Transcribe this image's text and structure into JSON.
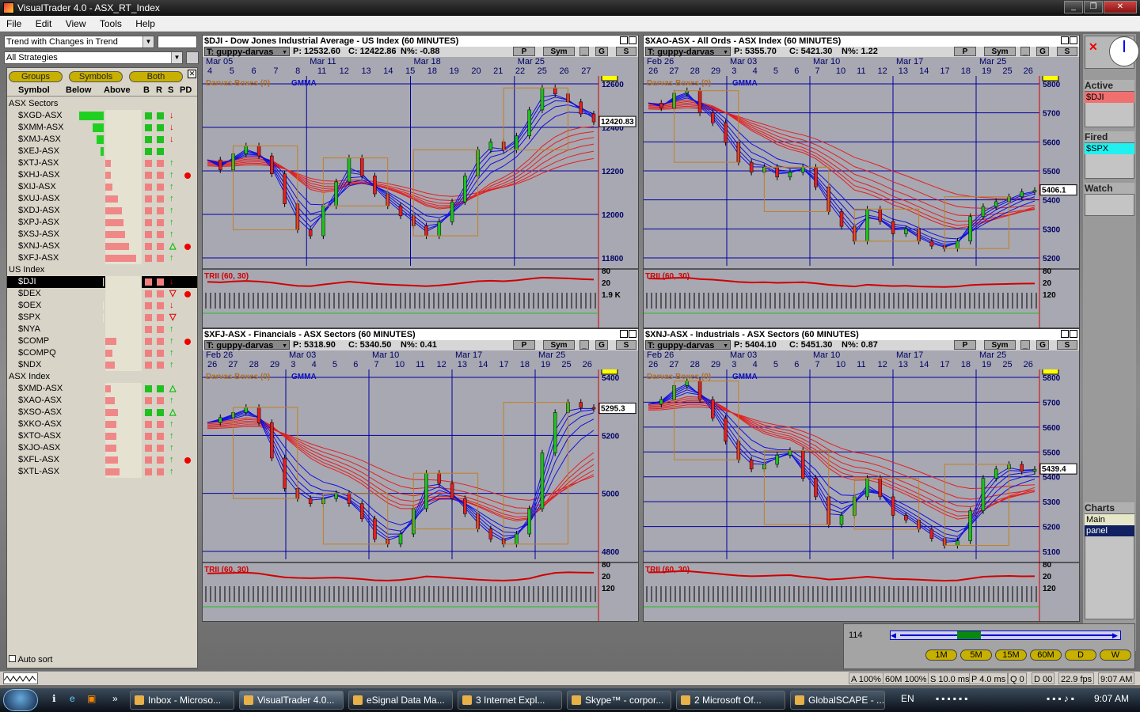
{
  "window": {
    "title": "VisualTrader 4.0 - ASX_RT_Index"
  },
  "menu": [
    "File",
    "Edit",
    "View",
    "Tools",
    "Help"
  ],
  "left": {
    "strategy": "Trend with Changes in Trend",
    "strategies_scope": "All Strategies",
    "buttons": [
      "Groups",
      "Symbols",
      "Both"
    ],
    "headers": [
      "Symbol",
      "Below",
      "Above",
      "B",
      "R",
      "S",
      "PD"
    ],
    "groups": [
      {
        "name": "ASX Sectors",
        "rows": [
          {
            "sym": "$XGD-ASX",
            "below": 0.9,
            "above": 0,
            "b": "#20c020",
            "r": "#20c020",
            "s": "↓",
            "scol": "#e00000",
            "pd": false
          },
          {
            "sym": "$XMM-ASX",
            "below": 0.4,
            "above": 0,
            "b": "#20c020",
            "r": "#20c020",
            "s": "↓",
            "scol": "#e00000",
            "pd": false
          },
          {
            "sym": "$XMJ-ASX",
            "below": 0.25,
            "above": 0,
            "b": "#20c020",
            "r": "#20c020",
            "s": "↓",
            "scol": "#e00000",
            "pd": false
          },
          {
            "sym": "$XEJ-ASX",
            "below": 0.12,
            "above": 0,
            "b": "#20c020",
            "r": "#20c020",
            "s": "",
            "scol": "#e00000",
            "pd": false
          },
          {
            "sym": "$XTJ-ASX",
            "below": 0,
            "above": 0.15,
            "b": "#f08080",
            "r": "#f08080",
            "s": "↑",
            "scol": "#00c000",
            "pd": false
          },
          {
            "sym": "$XHJ-ASX",
            "below": 0,
            "above": 0.15,
            "b": "#f08080",
            "r": "#f08080",
            "s": "↑",
            "scol": "#00c000",
            "pd": true
          },
          {
            "sym": "$XIJ-ASX",
            "below": 0,
            "above": 0.2,
            "b": "#f08080",
            "r": "#f08080",
            "s": "↑",
            "scol": "#00c000",
            "pd": false
          },
          {
            "sym": "$XUJ-ASX",
            "below": 0,
            "above": 0.35,
            "b": "#f08080",
            "r": "#f08080",
            "s": "↑",
            "scol": "#00c000",
            "pd": false
          },
          {
            "sym": "$XDJ-ASX",
            "below": 0,
            "above": 0.45,
            "b": "#f08080",
            "r": "#f08080",
            "s": "↑",
            "scol": "#00c000",
            "pd": false
          },
          {
            "sym": "$XPJ-ASX",
            "below": 0,
            "above": 0.5,
            "b": "#f08080",
            "r": "#f08080",
            "s": "↑",
            "scol": "#00c000",
            "pd": false
          },
          {
            "sym": "$XSJ-ASX",
            "below": 0,
            "above": 0.55,
            "b": "#f08080",
            "r": "#f08080",
            "s": "↑",
            "scol": "#00c000",
            "pd": false
          },
          {
            "sym": "$XNJ-ASX",
            "below": 0,
            "above": 0.65,
            "b": "#f08080",
            "r": "#f08080",
            "s": "△",
            "scol": "#00c000",
            "pd": true
          },
          {
            "sym": "$XFJ-ASX",
            "below": 0,
            "above": 0.85,
            "b": "#f08080",
            "r": "#f08080",
            "s": "↑",
            "scol": "#00c000",
            "pd": false
          }
        ]
      },
      {
        "name": "US Index",
        "rows": [
          {
            "sym": "$DJI",
            "below": 0.03,
            "above": 0,
            "b": "#f08080",
            "r": "#f08080",
            "s": "↓",
            "scol": "#e00000",
            "pd": false,
            "sel": true
          },
          {
            "sym": "$DEX",
            "below": 0,
            "above": 0,
            "b": "#f08080",
            "r": "#f08080",
            "s": "▽",
            "scol": "#e00000",
            "pd": true
          },
          {
            "sym": "$OEX",
            "below": 0.03,
            "above": 0,
            "b": "#f08080",
            "r": "#f08080",
            "s": "↓",
            "scol": "#e00000",
            "pd": false
          },
          {
            "sym": "$SPX",
            "below": 0.03,
            "above": 0,
            "b": "#f08080",
            "r": "#f08080",
            "s": "▽",
            "scol": "#e00000",
            "pd": false
          },
          {
            "sym": "$NYA",
            "below": 0,
            "above": 0,
            "b": "#f08080",
            "r": "#f08080",
            "s": "↑",
            "scol": "#00c000",
            "pd": false
          },
          {
            "sym": "$COMP",
            "below": 0,
            "above": 0.3,
            "b": "#f08080",
            "r": "#f08080",
            "s": "↑",
            "scol": "#00c000",
            "pd": true
          },
          {
            "sym": "$COMPQ",
            "below": 0,
            "above": 0.2,
            "b": "#f08080",
            "r": "#f08080",
            "s": "↑",
            "scol": "#00c000",
            "pd": false
          },
          {
            "sym": "$NDX",
            "below": 0,
            "above": 0.25,
            "b": "#f08080",
            "r": "#f08080",
            "s": "↑",
            "scol": "#00c000",
            "pd": false
          }
        ]
      },
      {
        "name": "ASX Index",
        "rows": [
          {
            "sym": "$XMD-ASX",
            "below": 0,
            "above": 0.15,
            "b": "#20c020",
            "r": "#20c020",
            "s": "△",
            "scol": "#00c000",
            "pd": false
          },
          {
            "sym": "$XAO-ASX",
            "below": 0,
            "above": 0.25,
            "b": "#f08080",
            "r": "#f08080",
            "s": "↑",
            "scol": "#00c000",
            "pd": false
          },
          {
            "sym": "$XSO-ASX",
            "below": 0,
            "above": 0.35,
            "b": "#20c020",
            "r": "#20c020",
            "s": "△",
            "scol": "#00c000",
            "pd": false
          },
          {
            "sym": "$XKO-ASX",
            "below": 0,
            "above": 0.3,
            "b": "#f08080",
            "r": "#f08080",
            "s": "↑",
            "scol": "#00c000",
            "pd": false
          },
          {
            "sym": "$XTO-ASX",
            "below": 0,
            "above": 0.3,
            "b": "#f08080",
            "r": "#f08080",
            "s": "↑",
            "scol": "#00c000",
            "pd": false
          },
          {
            "sym": "$XJO-ASX",
            "below": 0,
            "above": 0.3,
            "b": "#f08080",
            "r": "#f08080",
            "s": "↑",
            "scol": "#00c000",
            "pd": false
          },
          {
            "sym": "$XFL-ASX",
            "below": 0,
            "above": 0.35,
            "b": "#f08080",
            "r": "#f08080",
            "s": "↑",
            "scol": "#00c000",
            "pd": true
          },
          {
            "sym": "$XTL-ASX",
            "below": 0,
            "above": 0.4,
            "b": "#f08080",
            "r": "#f08080",
            "s": "↑",
            "scol": "#00c000",
            "pd": false
          }
        ]
      }
    ],
    "autosort": "Auto sort"
  },
  "charts": [
    {
      "id": "dji",
      "title": "$DJI - Dow Jones Industrial Average - US Index (60 MINUTES)",
      "tool": "T: guppy-darvas",
      "p": "P: 12532.60",
      "c": "C: 12422.86",
      "n": "N%: -0.88",
      "dates": [
        "Mar 05",
        "Mar 11",
        "Mar 18",
        "Mar 25"
      ],
      "days": [
        "4",
        "5",
        "6",
        "7",
        "8",
        "11",
        "12",
        "13",
        "14",
        "15",
        "18",
        "19",
        "20",
        "21",
        "22",
        "25",
        "26",
        "27"
      ],
      "yticks": [
        "12600",
        "12400",
        "12200",
        "12000",
        "11800"
      ],
      "last": "12420.83",
      "ind": [
        "80",
        "20",
        "1.9 K"
      ],
      "labels": [
        "Darvas Boxes (0)",
        "GMMA",
        "TRII (60, 30)"
      ],
      "chart_data": {
        "type": "line",
        "series": [
          {
            "values": [
              12230,
              12180,
              12260,
              12300,
              12250,
              12160,
              12010,
              11880,
              11850,
              12000,
              12120,
              12240,
              12150,
              12060,
              12000,
              11950,
              11900,
              11850,
              11920,
              12020,
              12150,
              12280,
              12320,
              12280,
              12350,
              12480,
              12590,
              12560,
              12520,
              12460,
              12420
            ]
          }
        ],
        "ylim": [
          11700,
          12650
        ]
      }
    },
    {
      "id": "xao",
      "title": "$XAO-ASX - All Ords - ASX Index (60 MINUTES)",
      "tool": "T: guppy-darvas",
      "p": "P: 5355.70",
      "c": "C: 5421.30",
      "n": "N%: 1.22",
      "dates": [
        "Feb 26",
        "Mar 03",
        "Mar 10",
        "Mar 17",
        "Mar 25"
      ],
      "days": [
        "26",
        "27",
        "28",
        "29",
        "3",
        "4",
        "5",
        "6",
        "7",
        "10",
        "11",
        "12",
        "13",
        "14",
        "17",
        "18",
        "19",
        "25",
        "26"
      ],
      "yticks": [
        "5800",
        "5700",
        "5600",
        "5500",
        "5400",
        "5300",
        "5200"
      ],
      "last": "5406.1",
      "ind": [
        "80",
        "20",
        "120"
      ],
      "labels": [
        "Darvas Boxes (0)",
        "GMMA",
        "TRII (60, 30)"
      ],
      "chart_data": {
        "type": "line",
        "series": [
          {
            "values": [
              5760,
              5740,
              5800,
              5810,
              5720,
              5680,
              5600,
              5520,
              5480,
              5500,
              5460,
              5480,
              5500,
              5420,
              5320,
              5260,
              5200,
              5330,
              5280,
              5230,
              5250,
              5200,
              5180,
              5170,
              5200,
              5300,
              5340,
              5360,
              5380,
              5400,
              5406
            ]
          }
        ],
        "ylim": [
          5100,
          5870
        ]
      }
    },
    {
      "id": "xfj",
      "title": "$XFJ-ASX - Financials - ASX Sectors (60 MINUTES)",
      "tool": "T: guppy-darvas",
      "p": "P: 5318.90",
      "c": "C: 5340.50",
      "n": "N%: 0.41",
      "dates": [
        "Feb 26",
        "Mar 03",
        "Mar 10",
        "Mar 17",
        "Mar 25"
      ],
      "days": [
        "26",
        "27",
        "28",
        "29",
        "3",
        "4",
        "5",
        "6",
        "7",
        "10",
        "11",
        "12",
        "13",
        "14",
        "17",
        "18",
        "19",
        "25",
        "26"
      ],
      "yticks": [
        "5400",
        "5200",
        "5000",
        "4800"
      ],
      "last": "5295.3",
      "ind": [
        "80",
        "20",
        "120"
      ],
      "labels": [
        "Darvas Boxes (0)",
        "GMMA",
        "TRII (60, 30)"
      ],
      "chart_data": {
        "type": "line",
        "series": [
          {
            "values": [
              5240,
              5260,
              5280,
              5300,
              5240,
              5100,
              4980,
              4940,
              4920,
              4940,
              4960,
              4920,
              4860,
              4780,
              4760,
              4800,
              4900,
              5040,
              5000,
              4940,
              4880,
              4820,
              4780,
              4760,
              4800,
              4900,
              5120,
              5280,
              5320,
              5300,
              5295
            ]
          }
        ],
        "ylim": [
          4700,
          5450
        ]
      }
    },
    {
      "id": "xnj",
      "title": "$XNJ-ASX - Industrials - ASX Sectors (60 MINUTES)",
      "tool": "T: guppy-darvas",
      "p": "P: 5404.10",
      "c": "C: 5451.30",
      "n": "N%: 0.87",
      "dates": [
        "Feb 26",
        "Mar 03",
        "Mar 10",
        "Mar 17",
        "Mar 25"
      ],
      "days": [
        "26",
        "27",
        "28",
        "29",
        "3",
        "4",
        "5",
        "6",
        "7",
        "10",
        "11",
        "12",
        "13",
        "14",
        "17",
        "18",
        "19",
        "25",
        "26"
      ],
      "yticks": [
        "5800",
        "5700",
        "5600",
        "5500",
        "5400",
        "5300",
        "5200",
        "5100"
      ],
      "last": "5439.4",
      "ind": [
        "80",
        "20",
        "120"
      ],
      "labels": [
        "Darvas Boxes (0)",
        "GMMA",
        "TRII (60, 30)"
      ],
      "chart_data": {
        "type": "line",
        "series": [
          {
            "values": [
              5720,
              5740,
              5800,
              5820,
              5740,
              5660,
              5560,
              5480,
              5440,
              5460,
              5500,
              5520,
              5400,
              5320,
              5200,
              5240,
              5320,
              5400,
              5320,
              5240,
              5220,
              5180,
              5140,
              5110,
              5130,
              5260,
              5400,
              5440,
              5460,
              5430,
              5439
            ]
          }
        ],
        "ylim": [
          5050,
          5870
        ]
      }
    }
  ],
  "toolbar_btns": [
    "P",
    "Sym",
    "_",
    "G",
    "S"
  ],
  "right": {
    "active_label": "Active",
    "active_item": "$DJI",
    "active_color": "#f07070",
    "fired_label": "Fired",
    "fired_item": "$SPX",
    "fired_color": "#20f0f0",
    "watch_label": "Watch",
    "charts_label": "Charts",
    "charts_items": [
      "Main",
      "panel"
    ]
  },
  "timeframe": {
    "count": "114",
    "buttons": [
      "1M",
      "5M",
      "15M",
      "60M",
      "D",
      "W"
    ]
  },
  "status": [
    "A 100%",
    "60M 100%",
    "S 10.0 ms",
    "P 4.0 ms",
    "Q 0",
    "D 00",
    "22.9 fps",
    "9:07 AM"
  ],
  "taskbar": {
    "buttons": [
      "Inbox - Microso...",
      "VisualTrader 4.0...",
      "eSignal Data Ma...",
      "3 Internet Expl...",
      "Skype™ - corpor...",
      "2 Microsoft Of...",
      "GlobalSCAPE - ..."
    ],
    "lang": "EN",
    "clock": "9:07 AM"
  }
}
